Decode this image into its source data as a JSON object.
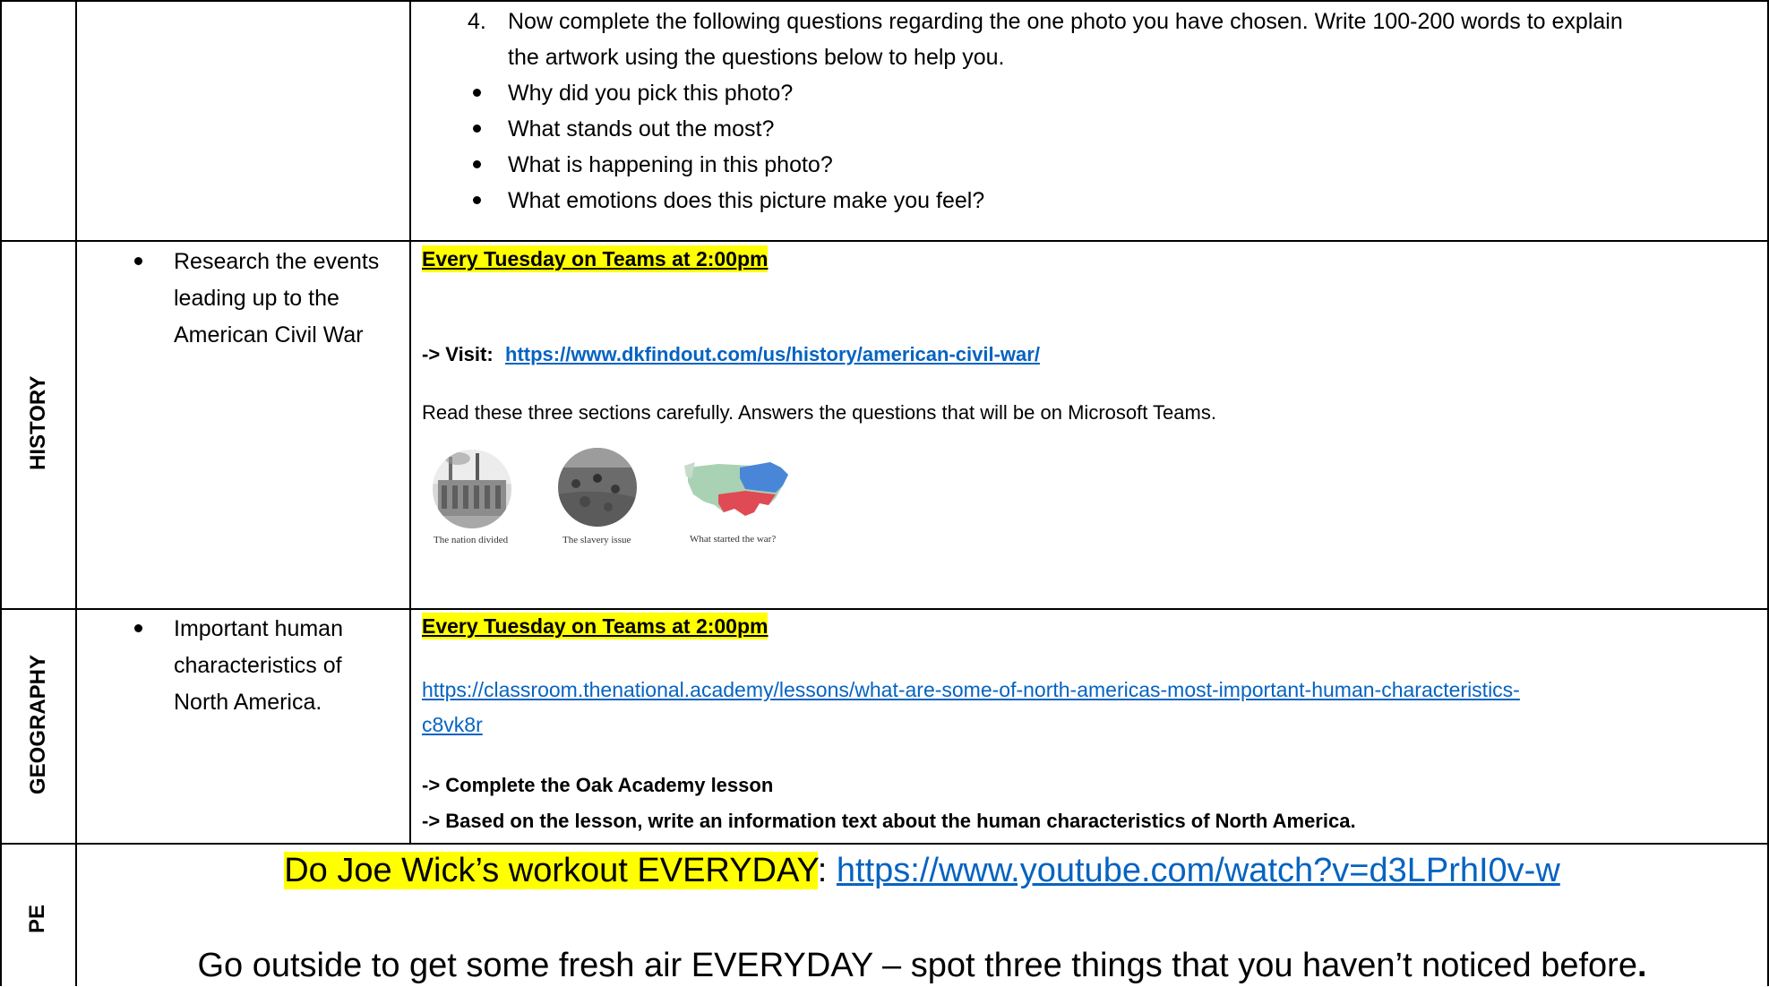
{
  "art_row": {
    "step_number": "4.",
    "step_text_line1": "Now complete the following questions regarding the one photo you have chosen. Write 100-200 words to explain",
    "step_text_line2": "the artwork using the questions below to help you.",
    "questions": [
      "Why did you pick this photo?",
      "What stands out the most?",
      "What is happening in this photo?",
      "What emotions does this picture make you feel?"
    ]
  },
  "history_row": {
    "subject": "HISTORY",
    "objective_lines": [
      "Research the events",
      "leading up to the",
      "American Civil War"
    ],
    "schedule": "Every Tuesday on Teams at 2:00pm",
    "visit_prefix": "-> Visit:",
    "visit_link": "https://www.dkfindout.com/us/history/american-civil-war/",
    "instruction": "Read these three sections carefully. Answers the questions that will be on Microsoft Teams.",
    "sections": [
      {
        "caption": "The nation divided",
        "icon": "factory-photo-icon"
      },
      {
        "caption": "The slavery issue",
        "icon": "field-photo-icon"
      },
      {
        "caption": "What started the war?",
        "icon": "us-map-icon"
      }
    ]
  },
  "geography_row": {
    "subject": "GEOGRAPHY",
    "objective_lines": [
      "Important human",
      "characteristics of",
      "North America."
    ],
    "schedule": "Every Tuesday on Teams at 2:00pm",
    "link_line1": "https://classroom.thenational.academy/lessons/what-are-some-of-north-americas-most-important-human-characteristics-",
    "link_line2": "c8vk8r",
    "task1": "-> Complete the Oak Academy lesson",
    "task2": "-> Based on the lesson, write an information text about the human characteristics of North America."
  },
  "pe_row": {
    "subject": "PE",
    "workout_text": "Do Joe Wick’s workout EVERYDAY",
    "workout_colon": ":",
    "workout_link": "https://www.youtube.com/watch?v=d3LPrhI0v-w",
    "outside_text": "Go outside to get some fresh air EVERYDAY – spot three things that you haven’t noticed before",
    "outside_end": "."
  },
  "colors": {
    "highlight": "#ffff00",
    "link": "#0563c1",
    "border": "#000000"
  }
}
